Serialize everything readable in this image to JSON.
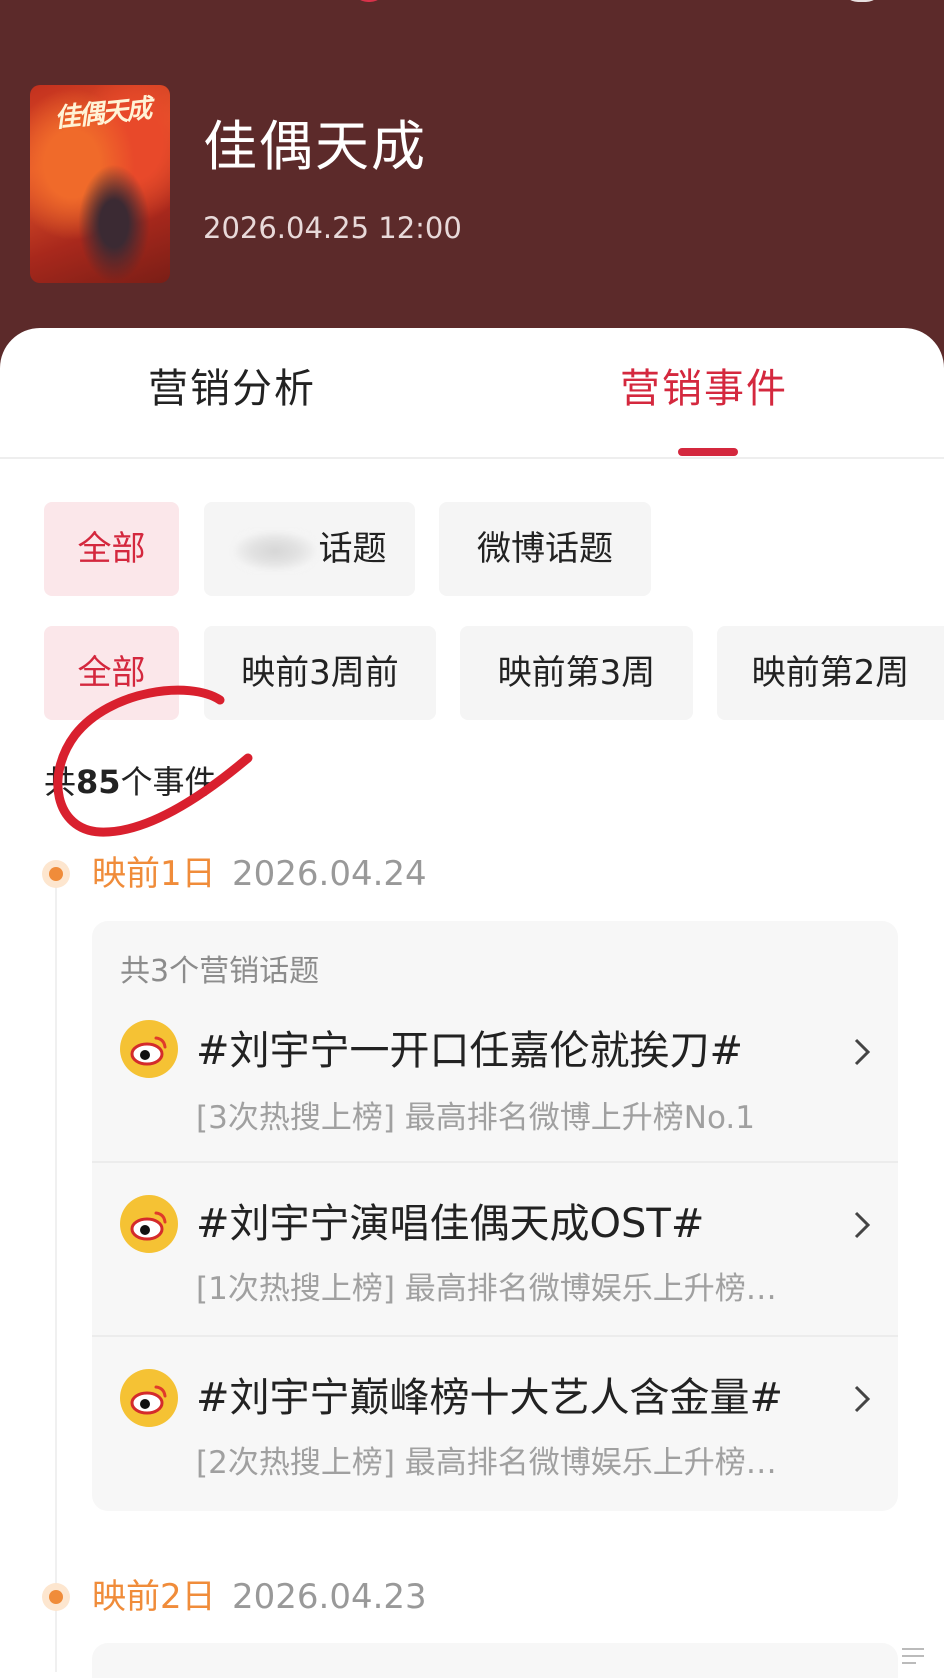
{
  "movie": {
    "title": "佳偶天成",
    "poster_title": "佳偶天成",
    "release_time": "2026.04.25 12:00"
  },
  "tabs": [
    {
      "label": "营销分析",
      "active": false
    },
    {
      "label": "营销事件",
      "active": true
    }
  ],
  "filters_source": [
    {
      "label": "全部",
      "active": true
    },
    {
      "label": "话题",
      "active": false,
      "blurred_prefix": true
    },
    {
      "label": "微博话题",
      "active": false
    }
  ],
  "filters_period": [
    {
      "label": "全部",
      "active": true
    },
    {
      "label": "映前3周前",
      "active": false
    },
    {
      "label": "映前第3周",
      "active": false
    },
    {
      "label": "映前第2周",
      "active": false
    }
  ],
  "summary": {
    "prefix": "共",
    "count": "85",
    "suffix": "个事件"
  },
  "timeline": [
    {
      "day_label": "映前1日",
      "date": "2026.04.24",
      "group_count": "共3个营销话题",
      "topics": [
        {
          "title": "#刘宇宁一开口任嘉伦就挨刀#",
          "detail": "[3次热搜上榜] 最高排名微博上升榜No.1"
        },
        {
          "title": "#刘宇宁演唱佳偶天成OST#",
          "detail": "[1次热搜上榜] 最高排名微博娱乐上升榜…"
        },
        {
          "title": "#刘宇宁巅峰榜十大艺人含金量#",
          "detail": "[2次热搜上榜] 最高排名微博娱乐上升榜…"
        }
      ]
    },
    {
      "day_label": "映前2日",
      "date": "2026.04.23"
    }
  ],
  "colors": {
    "header_bg": "#5c2a2a",
    "accent": "#d4283e",
    "timeline_orange": "#f08c3a",
    "weibo_yellow": "#f5c234"
  },
  "icons": {
    "topic_icon": "weibo-icon",
    "row_arrow": "chevron-right-icon"
  }
}
